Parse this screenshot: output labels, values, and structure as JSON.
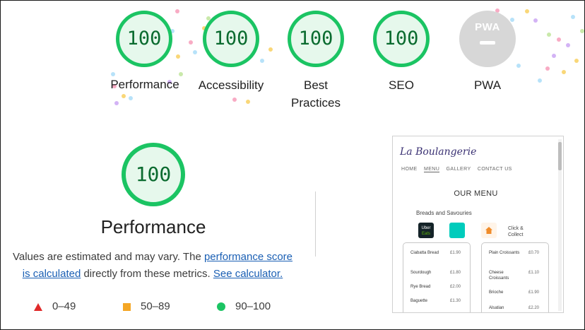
{
  "categories": [
    {
      "label": "Performance",
      "score": "100"
    },
    {
      "label": "Accessibility",
      "score": "100"
    },
    {
      "label": "Best Practices",
      "score": "100"
    },
    {
      "label": "SEO",
      "score": "100"
    },
    {
      "label": "PWA",
      "score": ""
    }
  ],
  "pwa_mark": "PWA",
  "detail": {
    "score": "100",
    "title": "Performance",
    "desc_prefix": "Values are estimated and may vary. The ",
    "desc_link1": "performance score is calculated",
    "desc_middle": " directly from these metrics. ",
    "desc_link2": "See calculator."
  },
  "legend": [
    {
      "range": "0–49",
      "icon": "triangle-icon",
      "color": "#e02a2a"
    },
    {
      "range": "50–89",
      "icon": "square-icon",
      "color": "#f4a625"
    },
    {
      "range": "90–100",
      "icon": "circle-icon",
      "color": "#1bc463"
    }
  ],
  "screenshot": {
    "brand": "La Boulangerie",
    "nav": [
      "HOME",
      "MENU",
      "GALLERY",
      "CONTACT US"
    ],
    "heading": "OUR MENU",
    "subheading": "Breads and Savouries",
    "uber_line1": "Uber",
    "uber_line2": "Eats",
    "click_collect_line1": "Click &",
    "click_collect_line2": "Collect",
    "left_menu": [
      {
        "name": "Ciabatta Bread",
        "price": "£1.90"
      },
      {
        "name": "Sourdough",
        "price": "£1.80"
      },
      {
        "name": "Rye Bread",
        "price": "£2.00"
      },
      {
        "name": "Baguette",
        "price": "£1.30"
      }
    ],
    "right_menu": [
      {
        "name": "Plain Croissants",
        "price": "£0.70"
      },
      {
        "name": "Cheese Croissants",
        "price": "£1.10"
      },
      {
        "name": "Brioche",
        "price": "£1.90"
      },
      {
        "name": "Alsatian",
        "price": "£2.20"
      }
    ]
  },
  "colors": {
    "pass": "#1bc463",
    "average": "#f4a625",
    "fail": "#e02a2a",
    "link": "#1a5fb4"
  }
}
